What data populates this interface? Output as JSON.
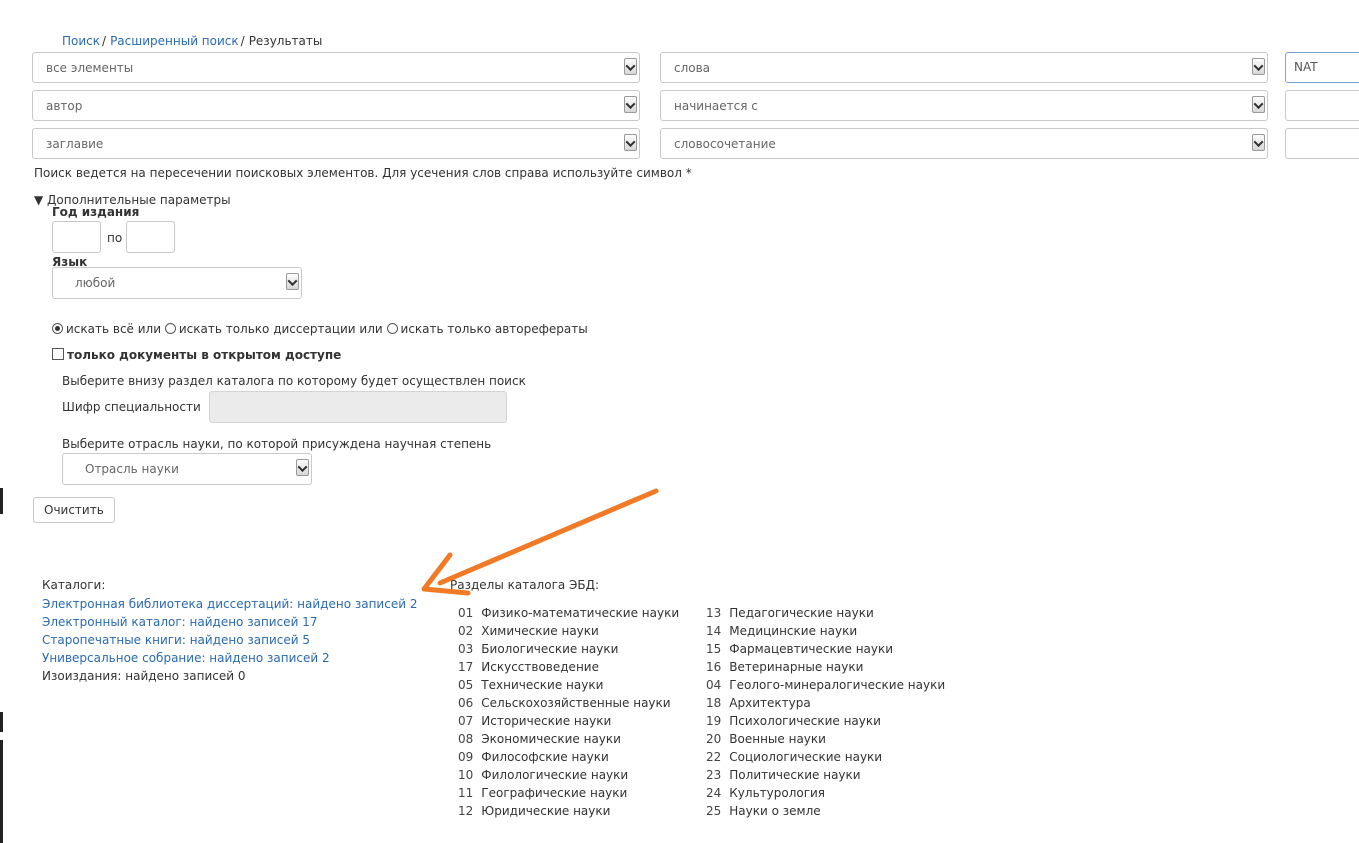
{
  "breadcrumb": {
    "search": "Поиск",
    "advanced": "Расширенный поиск",
    "results": "Результаты",
    "separator": "/"
  },
  "search_rows": [
    {
      "field": "все элементы",
      "mode": "слова",
      "value": "NAT"
    },
    {
      "field": "автор",
      "mode": "начинается с",
      "value": ""
    },
    {
      "field": "заглавие",
      "mode": "словосочетание",
      "value": ""
    }
  ],
  "hint": "Поиск ведется на пересечении поисковых элементов. Для усечения слов справа используйте символ *",
  "params": {
    "toggle_label": "▼ Дополнительные параметры",
    "year_label": "Год издания",
    "year_to": "по",
    "lang_label": "Язык",
    "lang_value": "любой"
  },
  "scope": {
    "all": "искать всё или",
    "dissertations": "искать только диссертации или",
    "abstracts": "искать только автореферaты"
  },
  "open_access_label": "только документы в открытом доступе",
  "catalog_section_prompt": "Выберите внизу раздел каталога по которому будет осуществлен поиск",
  "specialty_label": "Шифр специальности",
  "branch_prompt": "Выберите отрасль науки, по которой присуждена научная степень",
  "branch_placeholder": "Отрасль науки",
  "clear_button": "Очистить",
  "catalogs": {
    "title": "Каталоги:",
    "items": [
      {
        "text": "Электронная библиотека диссертаций: найдено записей 2",
        "link": true
      },
      {
        "text": "Электронный каталог: найдено записей 17",
        "link": true
      },
      {
        "text": "Старопечатные книги: найдено записей 5",
        "link": true
      },
      {
        "text": "Универсальное собрание: найдено записей 2",
        "link": true
      },
      {
        "text": "Изоиздания: найдено записей 0",
        "link": false
      }
    ]
  },
  "sections": {
    "title": "Разделы каталога ЭБД:",
    "col1": [
      {
        "num": "01",
        "name": "Физико-математические науки"
      },
      {
        "num": "02",
        "name": "Химические науки"
      },
      {
        "num": "03",
        "name": "Биологические науки"
      },
      {
        "num": "17",
        "name": "Искусствоведение"
      },
      {
        "num": "05",
        "name": "Технические науки"
      },
      {
        "num": "06",
        "name": "Сельскохозяйственные науки"
      },
      {
        "num": "07",
        "name": "Исторические науки"
      },
      {
        "num": "08",
        "name": "Экономические науки"
      },
      {
        "num": "09",
        "name": "Философские науки"
      },
      {
        "num": "10",
        "name": "Филологические науки"
      },
      {
        "num": "11",
        "name": "Географические науки"
      },
      {
        "num": "12",
        "name": "Юридические науки"
      }
    ],
    "col2": [
      {
        "num": "13",
        "name": "Педагогические науки"
      },
      {
        "num": "14",
        "name": "Медицинские науки"
      },
      {
        "num": "15",
        "name": "Фармацевтические науки"
      },
      {
        "num": "16",
        "name": "Ветеринарные науки"
      },
      {
        "num": "04",
        "name": "Геолого-минералогические науки"
      },
      {
        "num": "18",
        "name": "Архитектура"
      },
      {
        "num": "19",
        "name": "Психологические науки"
      },
      {
        "num": "20",
        "name": "Военные науки"
      },
      {
        "num": "22",
        "name": "Социологические науки"
      },
      {
        "num": "23",
        "name": "Политические науки"
      },
      {
        "num": "24",
        "name": "Культурология"
      },
      {
        "num": "25",
        "name": "Науки о земле"
      }
    ]
  },
  "colors": {
    "link": "#2a6ab0",
    "annotation_arrow": "#f07a26"
  },
  "icons": {
    "dropdown": "chevron-down-icon",
    "annotation": "arrow-icon"
  }
}
